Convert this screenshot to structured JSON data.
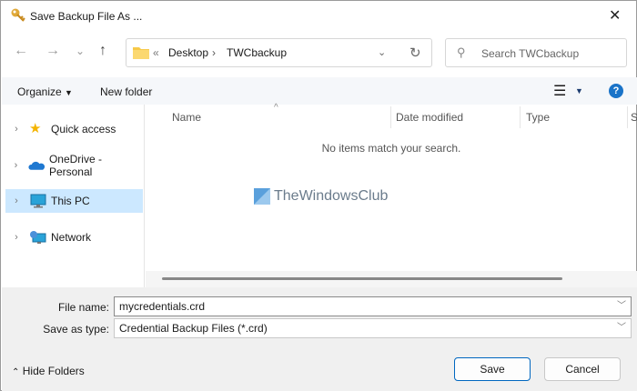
{
  "window": {
    "title": "Save Backup File As ...",
    "icon": "key-icon"
  },
  "nav": {
    "back": "←",
    "forward": "→",
    "recent": "⌄",
    "up": "↑"
  },
  "address": {
    "overflow": "«",
    "crumbs": [
      "Desktop",
      "TWCbackup"
    ],
    "separator": "›"
  },
  "search": {
    "placeholder": "Search TWCbackup"
  },
  "toolbar": {
    "organize": "Organize",
    "new_folder": "New folder"
  },
  "sidebar": {
    "items": [
      {
        "label": "Quick access",
        "icon": "star-icon"
      },
      {
        "label": "OneDrive - Personal",
        "icon": "cloud-icon"
      },
      {
        "label": "This PC",
        "icon": "computer-icon",
        "selected": true
      },
      {
        "label": "Network",
        "icon": "network-icon"
      }
    ]
  },
  "columns": [
    "Name",
    "Date modified",
    "Type",
    "S"
  ],
  "empty_message": "No items match your search.",
  "watermark": "TheWindowsClub",
  "form": {
    "file_name_label": "File name:",
    "file_name_value": "mycredentials.crd",
    "type_label": "Save as type:",
    "type_value": "Credential Backup Files (*.crd)"
  },
  "footer": {
    "hide_folders": "Hide Folders",
    "save": "Save",
    "cancel": "Cancel"
  },
  "colors": {
    "selection": "#cce8ff",
    "help": "#1a73c8",
    "folder": "#f7c948",
    "accent_border": "#0067c0"
  }
}
